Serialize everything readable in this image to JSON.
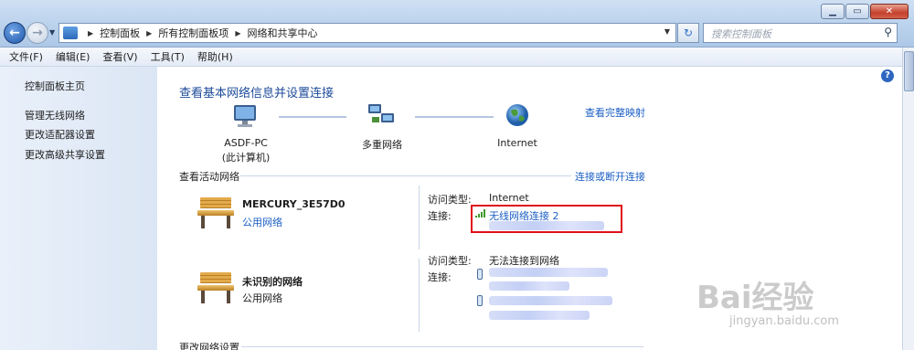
{
  "window": {
    "controls": {
      "minimize_icon": "minimize-icon",
      "maximize_icon": "maximize-icon",
      "close_icon": "close-icon"
    }
  },
  "address_bar": {
    "breadcrumbs": [
      "控制面板",
      "所有控制面板项",
      "网络和共享中心"
    ],
    "search_placeholder": "搜索控制面板"
  },
  "menu": [
    "文件(F)",
    "编辑(E)",
    "查看(V)",
    "工具(T)",
    "帮助(H)"
  ],
  "sidebar": {
    "items": [
      {
        "label": "控制面板主页"
      },
      {
        "label": "管理无线网络"
      },
      {
        "label": "更改适配器设置"
      },
      {
        "label": "更改高级共享设置"
      }
    ]
  },
  "main": {
    "title": "查看基本网络信息并设置连接",
    "full_map_link": "查看完整映射",
    "map": {
      "this_pc_name": "ASDF-PC",
      "this_pc_sub": "(此计算机)",
      "middle_label": "多重网络",
      "internet_label": "Internet"
    },
    "active_section": {
      "title": "查看活动网络",
      "connect_link": "连接或断开连接",
      "networks": [
        {
          "name": "MERCURY_3E57D0",
          "type": "公用网络",
          "access_label": "访问类型:",
          "access_value": "Internet",
          "conn_label": "连接:",
          "conn_value": "无线网络连接 2"
        },
        {
          "name": "未识别的网络",
          "type": "公用网络",
          "access_label": "访问类型:",
          "access_value": "无法连接到网络",
          "conn_label": "连接:"
        }
      ]
    },
    "change_section": {
      "title": "更改网络设置"
    }
  },
  "watermark": {
    "text": "Bai经验",
    "sub": "jingyan.baidu.com"
  },
  "colors": {
    "link": "#1c5fc4",
    "title": "#1c4b9a",
    "highlight": "#e0101a"
  }
}
